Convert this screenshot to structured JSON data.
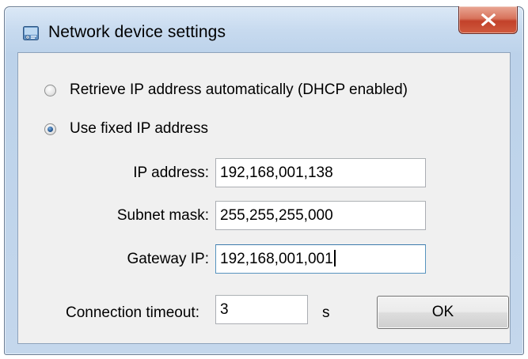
{
  "window": {
    "title": "Network device settings",
    "close_glyph": "X"
  },
  "ip_mode": {
    "options": [
      {
        "label": "Retrieve IP address automatically (DHCP enabled)",
        "selected": false
      },
      {
        "label": "Use fixed IP address",
        "selected": true
      }
    ]
  },
  "fields": {
    "ip_address": {
      "label": "IP address:",
      "value": "192,168,001,138"
    },
    "subnet_mask": {
      "label": "Subnet mask:",
      "value": "255,255,255,000"
    },
    "gateway_ip": {
      "label": "Gateway IP:",
      "value": "192,168,001,001"
    },
    "connection_timeout": {
      "label": "Connection timeout:",
      "value": "3",
      "unit": "s"
    }
  },
  "buttons": {
    "ok_label": "OK"
  },
  "icons": {
    "app": "network-settings-icon",
    "close": "close-icon"
  },
  "colors": {
    "close_button": "#c2412a",
    "focus_border": "#5794bf",
    "radio_dot": "#2c5f99"
  }
}
